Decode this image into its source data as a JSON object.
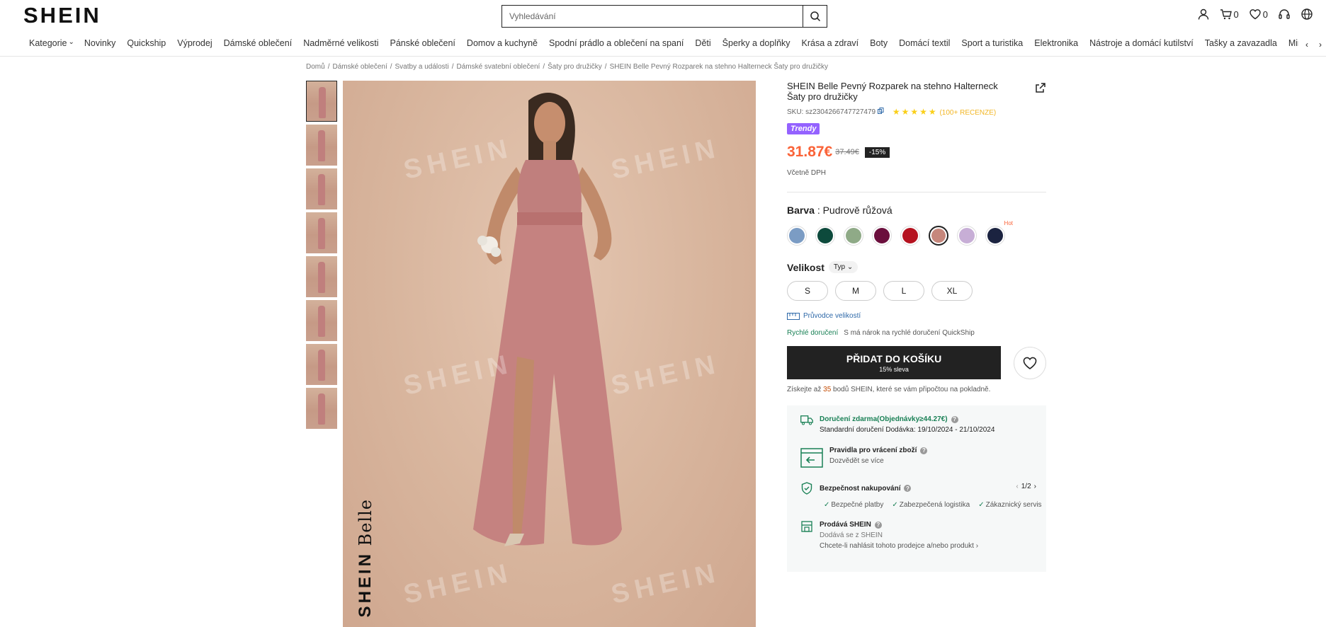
{
  "header": {
    "logo": "SHEIN",
    "search_placeholder": "Vyhledávání",
    "cart_count": "0",
    "wishlist_count": "0"
  },
  "nav": {
    "items": [
      "Kategorie",
      "Novinky",
      "Quickship",
      "Výprodej",
      "Dámské oblečení",
      "Nadměrné velikosti",
      "Pánské oblečení",
      "Domov a kuchyně",
      "Spodní prádlo a oblečení na spaní",
      "Děti",
      "Šperky a doplňky",
      "Krása a zdraví",
      "Boty",
      "Domácí textil",
      "Sport a turistika",
      "Elektronika",
      "Nástroje a domácí kutilství",
      "Tašky a zavazadla",
      "Miminko a ma"
    ]
  },
  "breadcrumb": [
    "Domů",
    "Dámské oblečení",
    "Svatby a události",
    "Dámské svatební oblečení",
    "Šaty pro družičky",
    "SHEIN Belle Pevný Rozparek na stehno Halterneck Šaty pro družičky"
  ],
  "gallery": {
    "thumb_count": 8,
    "watermark": "SHEIN",
    "brand_line1": "SHEIN",
    "brand_line2": "Belle"
  },
  "product": {
    "title": "SHEIN Belle Pevný Rozparek na stehno Halterneck Šaty pro družičky",
    "sku": "SKU: sz2304266747727479",
    "stars": "★★★★★",
    "reviews": "(100+ RECENZE)",
    "badge": "Trendy",
    "price": "31.87€",
    "old_price": "37.49€",
    "discount": "-15%",
    "vat_note": "Včetně DPH",
    "color_label": "Barva",
    "color_value": ": Pudrově růžová",
    "colors": [
      {
        "hex": "#7b9cc4",
        "active": false,
        "hot": false
      },
      {
        "hex": "#0d4a3c",
        "active": false,
        "hot": false
      },
      {
        "hex": "#8faa87",
        "active": false,
        "hot": false
      },
      {
        "hex": "#6b0f3d",
        "active": false,
        "hot": false
      },
      {
        "hex": "#b5121f",
        "active": false,
        "hot": false
      },
      {
        "hex": "#c6877c",
        "active": true,
        "hot": false
      },
      {
        "hex": "#c7aed6",
        "active": false,
        "hot": false
      },
      {
        "hex": "#1b2340",
        "active": false,
        "hot": true
      }
    ],
    "hot_label": "Hot",
    "size_label": "Velikost",
    "size_type": "Typ",
    "sizes": [
      "S",
      "M",
      "L",
      "XL"
    ],
    "size_guide": "Průvodce velikostí",
    "quick_delivery": "Rychlé doručení",
    "quick_delivery_note": "S má nárok na rychlé doručení QuickShip",
    "add_to_cart": "PŘIDAT DO KOŠÍKU",
    "add_to_cart_sub": "15% sleva",
    "points_prefix": "Získejte až",
    "points_value": "35",
    "points_suffix": "bodů SHEIN, které se vám připočtou na pokladně."
  },
  "info": {
    "shipping_title": "Doručení zdarma(Objednávky≥44.27€)",
    "shipping_sub": "Standardní doručení Dodávka: 19/10/2024 - 21/10/2024",
    "return_title": "Pravidla pro vrácení zboží",
    "return_sub": "Dozvědět se více",
    "security_title": "Bezpečnost nakupování",
    "pager": "1/2",
    "security_items": [
      "Bezpečné platby",
      "Zabezpečená logistika",
      "Zákaznický servis"
    ],
    "seller_title": "Prodává SHEIN",
    "seller_sub": "Dodává se z SHEIN",
    "seller_report": "Chcete-li nahlásit tohoto prodejce a/nebo produkt"
  }
}
